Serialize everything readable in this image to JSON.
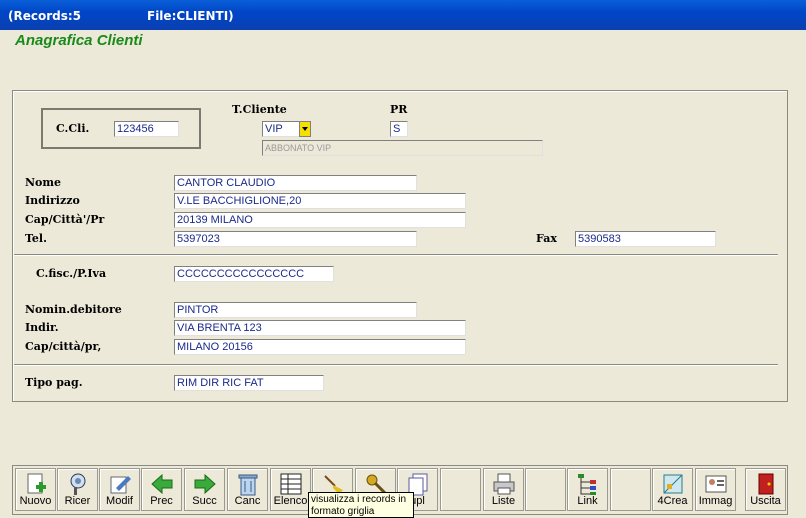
{
  "titlebar": {
    "records": "(Records:5",
    "file": "File:CLIENTI)"
  },
  "form_title": "Anagrafica Clienti",
  "fields": {
    "ccli": {
      "label": "C.Cli.",
      "value": "123456"
    },
    "tcliente": {
      "label": "T.Cliente",
      "value": "VIP",
      "description": "ABBONATO VIP"
    },
    "pr": {
      "label": "PR",
      "value": "S"
    },
    "nome": {
      "label": "Nome",
      "value": "CANTOR CLAUDIO"
    },
    "indirizzo": {
      "label": "Indirizzo",
      "value": "V.LE BACCHIGLIONE,20"
    },
    "cap": {
      "label": "Cap/Città'/Pr",
      "value": "20139 MILANO"
    },
    "tel": {
      "label": "Tel.",
      "value": "5397023"
    },
    "fax": {
      "label": "Fax",
      "value": "5390583"
    },
    "cfisc": {
      "label": "C.fisc./P.Iva",
      "value": "CCCCCCCCCCCCCCCC"
    },
    "nomin": {
      "label": "Nomin.debitore",
      "value": "PINTOR"
    },
    "indir": {
      "label": "Indir.",
      "value": "VIA BRENTA 123"
    },
    "capcitta": {
      "label": "Cap/città/pr,",
      "value": "MILANO  20156"
    },
    "tipopag": {
      "label": "Tipo pag.",
      "value": "RIM DIR RIC FAT"
    }
  },
  "toolbar": {
    "nuovo": "Nuovo",
    "ricer": "Ricer",
    "modif": "Modif",
    "prec": "Prec",
    "succ": "Succ",
    "canc": "Canc",
    "elenco": "Elenco",
    "dupl": "upl",
    "liste": "Liste",
    "link": "Link",
    "crea": "4Crea",
    "immag": "Immag",
    "uscita": "Uscita"
  },
  "tooltip": "visualizza i records in formato griglia",
  "colors": {
    "titlebar": "#0a4fd0",
    "form_title": "#1a8a1a",
    "field_text": "#1a2a8a",
    "dropdown": "#f6e000"
  }
}
